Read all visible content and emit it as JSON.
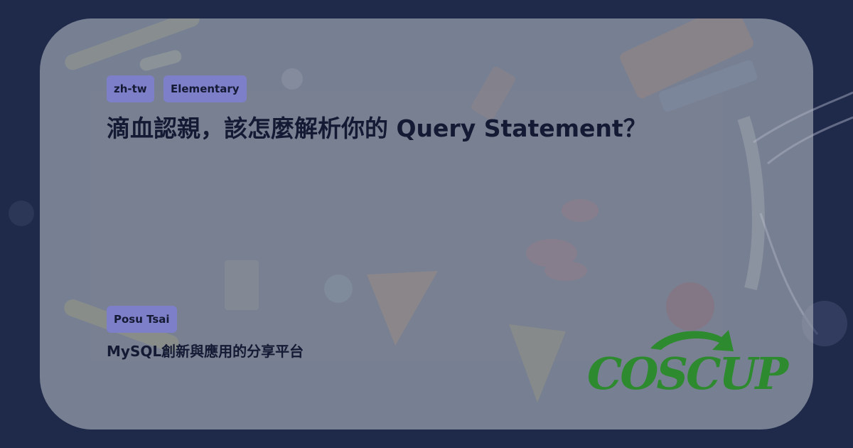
{
  "tags": {
    "language": "zh-tw",
    "level": "Elementary"
  },
  "title": "滴血認親，該怎麼解析你的 Query Statement？",
  "speaker": {
    "name": "Posu Tsai"
  },
  "subtitle": "MySQL創新與應用的分享平台",
  "logo": {
    "text": "COSCUP",
    "color": "#2e8a2e"
  },
  "colors": {
    "background": "#1f2a4a",
    "tag": "#7d7fc8",
    "text": "#141a33"
  }
}
